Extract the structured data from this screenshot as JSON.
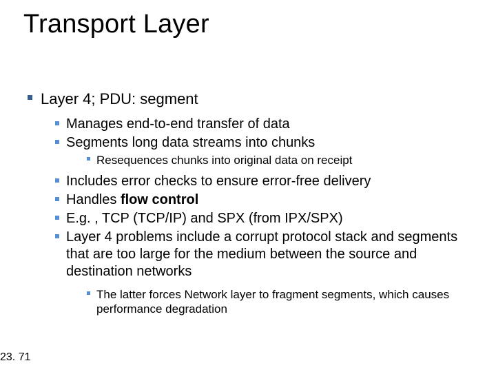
{
  "title": "Transport Layer",
  "lvl1": {
    "main": "Layer 4; PDU: segment"
  },
  "lvl2": {
    "a": "Manages end-to-end transfer of data",
    "b": "Segments long data streams into chunks",
    "c": "Includes error checks to ensure error-free delivery",
    "d_pre": "Handles ",
    "d_bold": "flow control",
    "e": "E.g. , TCP (TCP/IP) and SPX (from IPX/SPX)",
    "f": "Layer 4 problems include a corrupt protocol stack and segments that are too large for the medium between the source and destination networks"
  },
  "lvl3": {
    "a": "Resequences chunks into original data on receipt",
    "b": "The latter forces Network layer to fragment segments, which causes performance degradation"
  },
  "footer": "23. 71"
}
